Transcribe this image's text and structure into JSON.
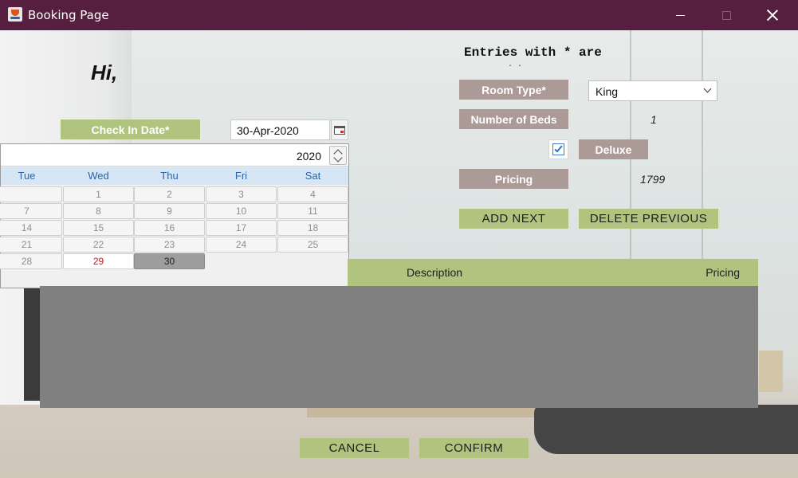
{
  "window": {
    "title": "Booking Page"
  },
  "greeting": "Hi,",
  "notice": {
    "text": "Entries with * are",
    "dots": ". ."
  },
  "check_in": {
    "label": "Check In Date*",
    "value": "30-Apr-2020"
  },
  "calendar": {
    "year": "2020",
    "weekdays": [
      "Tue",
      "Wed",
      "Thu",
      "Fri",
      "Sat"
    ],
    "rows": [
      [
        "",
        "1",
        "2",
        "3",
        "4"
      ],
      [
        "7",
        "8",
        "9",
        "10",
        "11"
      ],
      [
        "14",
        "15",
        "16",
        "17",
        "18"
      ],
      [
        "21",
        "22",
        "23",
        "24",
        "25"
      ],
      [
        "28",
        "29",
        "30",
        "",
        ""
      ]
    ],
    "today": "29",
    "selected": "30"
  },
  "room_type": {
    "label": "Room Type*",
    "value": "King"
  },
  "beds": {
    "label": "Number of Beds",
    "value": "1"
  },
  "deluxe": {
    "label": "Deluxe",
    "checked": true
  },
  "pricing": {
    "label": "Pricing",
    "value": "1799"
  },
  "actions": {
    "add_next": "ADD NEXT",
    "delete_previous": "DELETE PREVIOUS",
    "cancel": "CANCEL",
    "confirm": "CONFIRM"
  },
  "table": {
    "columns": [
      "Description",
      "Pricing"
    ],
    "rows": []
  },
  "colors": {
    "titlebar": "#561f40",
    "green": "#b0c47f",
    "mauve": "#ab9a96",
    "table_body": "#808080"
  }
}
